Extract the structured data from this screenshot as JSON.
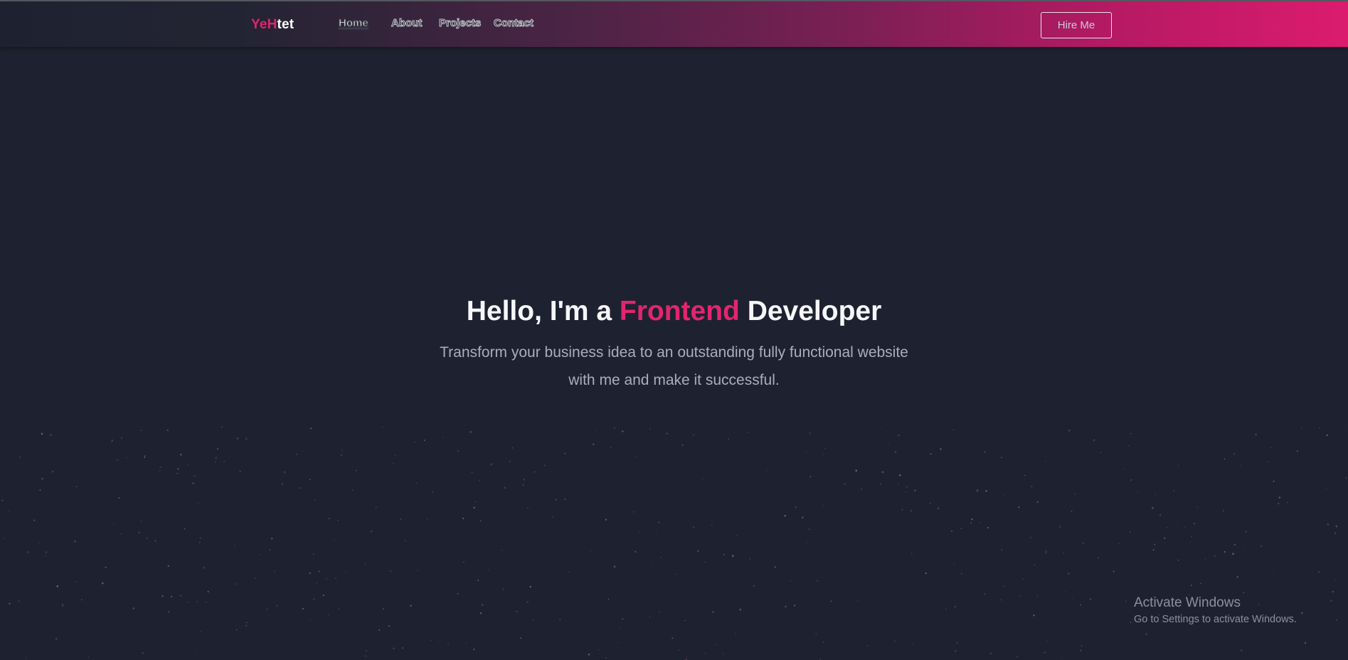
{
  "header": {
    "logo": {
      "part1": "Ye",
      "part2": "H",
      "part3": "tet"
    },
    "nav": [
      {
        "label": "Home"
      },
      {
        "label": "About"
      },
      {
        "label": "Projects"
      },
      {
        "label": "Contact"
      }
    ],
    "hire_label": "Hire Me"
  },
  "hero": {
    "title_pre": "Hello, I'm a ",
    "title_accent": "Frontend",
    "title_post": " Developer",
    "subtitle_line1": "Transform your business idea to an outstanding fully functional website",
    "subtitle_line2": "with me and make it successful."
  },
  "watermark": {
    "title": "Activate Windows",
    "subtitle": "Go to Settings to activate Windows."
  },
  "colors": {
    "background": "#1e2230",
    "accent": "#e3256f",
    "nav_gradient_end": "#dc1b6e"
  }
}
